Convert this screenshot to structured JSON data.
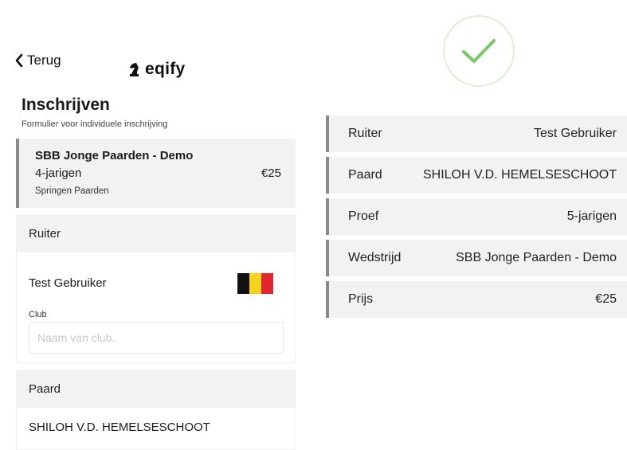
{
  "nav": {
    "back_label": "Terug",
    "brand": "eqify"
  },
  "form": {
    "title": "Inschrijven",
    "subtitle": "Formulier voor individuele inschrijving"
  },
  "event": {
    "name": "SBB Jonge Paarden - Demo",
    "class": "4-jarigen",
    "price": "€25",
    "discipline": "Springen Paarden"
  },
  "rider_section": {
    "heading": "Ruiter",
    "rider_name": "Test Gebruiker",
    "flag_colors": [
      "#111111",
      "#f7d21b",
      "#e2262f"
    ],
    "club_label": "Club",
    "club_placeholder": "Naam van club.."
  },
  "horse_section": {
    "heading": "Paard",
    "horse_name": "SHILOH V.D. HEMELSESCHOOT"
  },
  "confirmation": {
    "icon": "checkmark-icon",
    "accent_color": "#7cc46a",
    "summary": [
      {
        "label": "Ruiter",
        "value": "Test Gebruiker"
      },
      {
        "label": "Paard",
        "value": "SHILOH V.D. HEMELSESCHOOT"
      },
      {
        "label": "Proef",
        "value": "5-jarigen"
      },
      {
        "label": "Wedstrijd",
        "value": "SBB Jonge Paarden - Demo"
      },
      {
        "label": "Prijs",
        "value": "€25"
      }
    ]
  }
}
